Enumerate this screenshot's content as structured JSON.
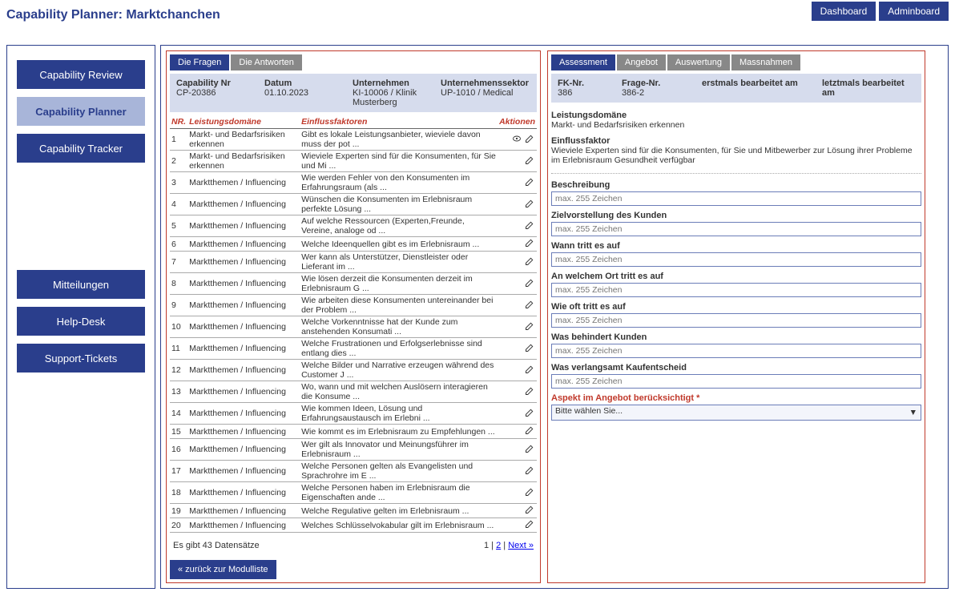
{
  "header": {
    "title": "Capability Planner: Marktchanchen",
    "top_buttons": [
      "Dashboard",
      "Adminboard"
    ]
  },
  "sidebar": {
    "items": [
      {
        "label": "Capability Review",
        "active": false
      },
      {
        "label": "Capability Planner",
        "active": true
      },
      {
        "label": "Capability Tracker",
        "active": false
      }
    ],
    "lower": [
      {
        "label": "Mitteilungen"
      },
      {
        "label": "Help-Desk"
      },
      {
        "label": "Support-Tickets"
      }
    ]
  },
  "left": {
    "tabs": [
      "Die Fragen",
      "Die Antworten"
    ],
    "active_tab": 0,
    "info": {
      "cap_nr_label": "Capability Nr",
      "cap_nr": "CP-20386",
      "datum_label": "Datum",
      "datum": "01.10.2023",
      "unt_label": "Unternehmen",
      "unt": "KI-10006 / Klinik Musterberg",
      "sektor_label": "Unternehmenssektor",
      "sektor": "UP-1010 / Medical"
    },
    "columns": {
      "nr": "NR.",
      "dom": "Leistungsdomäne",
      "faktor": "Einflussfaktoren",
      "akt": "Aktionen"
    },
    "rows": [
      {
        "nr": "1",
        "dom": "Markt- und Bedarfsrisiken erkennen",
        "faktor": "Gibt es lokale Leistungsanbieter, wieviele davon muss der pot ..."
      },
      {
        "nr": "2",
        "dom": "Markt- und Bedarfsrisiken erkennen",
        "faktor": "Wieviele Experten sind für die Konsumenten, für Sie und Mi ..."
      },
      {
        "nr": "3",
        "dom": "Marktthemen / Influencing",
        "faktor": "Wie werden Fehler von den Konsumenten im Erfahrungsraum (als ..."
      },
      {
        "nr": "4",
        "dom": "Marktthemen / Influencing",
        "faktor": "Wünschen die Konsumenten im Erlebnisraum  perfekte Lösung ..."
      },
      {
        "nr": "5",
        "dom": "Marktthemen / Influencing",
        "faktor": "Auf welche Ressourcen (Experten,Freunde, Vereine, analoge od ..."
      },
      {
        "nr": "6",
        "dom": "Marktthemen / Influencing",
        "faktor": "Welche Ideenquellen gibt es im Erlebnisraum ..."
      },
      {
        "nr": "7",
        "dom": "Marktthemen / Influencing",
        "faktor": "Wer kann als Unterstützer, Dienstleister oder Lieferant im ..."
      },
      {
        "nr": "8",
        "dom": "Marktthemen / Influencing",
        "faktor": "Wie lösen derzeit die Konsumenten derzeit im Erlebnisraum G ..."
      },
      {
        "nr": "9",
        "dom": "Marktthemen / Influencing",
        "faktor": "Wie arbeiten diese Konsumenten untereinander bei der Problem ..."
      },
      {
        "nr": "10",
        "dom": "Marktthemen / Influencing",
        "faktor": "Welche Vorkenntnisse hat der Kunde zum anstehenden Konsumati ..."
      },
      {
        "nr": "11",
        "dom": "Marktthemen / Influencing",
        "faktor": "Welche Frustrationen und Erfolgserlebnisse sind entlang dies ..."
      },
      {
        "nr": "12",
        "dom": "Marktthemen / Influencing",
        "faktor": "Welche Bilder und Narrative erzeugen während des Customer J ..."
      },
      {
        "nr": "13",
        "dom": "Marktthemen / Influencing",
        "faktor": "Wo, wann und mit welchen Auslösern interagieren die Konsume ..."
      },
      {
        "nr": "14",
        "dom": "Marktthemen / Influencing",
        "faktor": "Wie kommen Ideen, Lösung und Erfahrungsaustausch im Erlebni ..."
      },
      {
        "nr": "15",
        "dom": "Marktthemen / Influencing",
        "faktor": "Wie kommt es im Erlebnisraum zu Empfehlungen ..."
      },
      {
        "nr": "16",
        "dom": "Marktthemen / Influencing",
        "faktor": "Wer gilt als Innovator und Meinungsführer im Erlebnisraum ..."
      },
      {
        "nr": "17",
        "dom": "Marktthemen / Influencing",
        "faktor": "Welche Personen gelten als Evangelisten und Sprachrohre im E ..."
      },
      {
        "nr": "18",
        "dom": "Marktthemen / Influencing",
        "faktor": "Welche Personen haben im Erlebnisraum die Eigenschaften ande ..."
      },
      {
        "nr": "19",
        "dom": "Marktthemen / Influencing",
        "faktor": "Welche Regulative gelten im Erlebnisraum ..."
      },
      {
        "nr": "20",
        "dom": "Marktthemen / Influencing",
        "faktor": "Welches Schlüsselvokabular gilt im Erlebnisraum ..."
      }
    ],
    "footer": {
      "count": "Es gibt 43 Datensätze",
      "pager_prefix": "1 | ",
      "pager_page": "2",
      "pager_sep": " | ",
      "pager_next": "Next »"
    },
    "back_button": "«  zurück zur Modulliste"
  },
  "right": {
    "tabs": [
      "Assessment",
      "Angebot",
      "Auswertung",
      "Massnahmen"
    ],
    "active_tab": 0,
    "info": {
      "fk_label": "FK-Nr.",
      "fk": "386",
      "frage_label": "Frage-Nr.",
      "frage": "386-2",
      "erst_label": "erstmals bearbeitet am",
      "erst": "",
      "letz_label": "letztmals bearbeitet am",
      "letz": ""
    },
    "leistung_label": "Leistungsdomäne",
    "leistung_text": "Markt- und Bedarfsrisiken erkennen",
    "einfluss_label": "Einflussfaktor",
    "einfluss_text": "Wieviele Experten sind für die Konsumenten, für Sie und Mitbewerber zur Lösung ihrer Probleme im Erlebnisraum Gesundheit verfügbar",
    "fields": [
      {
        "label": "Beschreibung",
        "ph": "max. 255 Zeichen"
      },
      {
        "label": "Zielvorstellung des Kunden",
        "ph": "max. 255 Zeichen"
      },
      {
        "label": "Wann tritt es auf",
        "ph": "max. 255 Zeichen"
      },
      {
        "label": "An welchem Ort tritt es auf",
        "ph": "max. 255 Zeichen"
      },
      {
        "label": "Wie oft tritt es auf",
        "ph": "max. 255 Zeichen"
      },
      {
        "label": "Was behindert Kunden",
        "ph": "max. 255 Zeichen"
      },
      {
        "label": "Was verlangsamt Kaufentscheid",
        "ph": "max. 255 Zeichen"
      }
    ],
    "aspect": {
      "label": "Aspekt im Angebot berücksichtigt *",
      "selected": "Bitte wählen Sie..."
    }
  }
}
